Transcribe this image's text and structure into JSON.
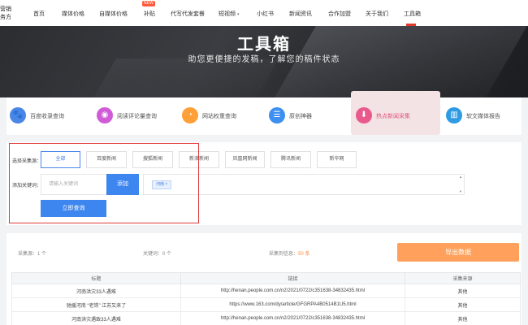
{
  "logo": {
    "line1": "营销",
    "line2": "务方"
  },
  "nav": {
    "items": [
      "首页",
      "媒体价格",
      "自媒体价格",
      "补贴",
      "代写代发套餐",
      "短视频",
      "小红书",
      "新闻资讯",
      "合作加盟",
      "关于我们",
      "工具箱"
    ],
    "badge": "NEW",
    "caret": "▾",
    "active": "工具箱"
  },
  "hero": {
    "title": "工具箱",
    "subtitle": "助您更便捷的发稿，了解您的稿件状态"
  },
  "tools": [
    {
      "label": "百度收录查询",
      "icon": "paw-icon",
      "color": "#4a86e8"
    },
    {
      "label": "阅读评论量查询",
      "icon": "eye-icon",
      "color": "#d05bd6"
    },
    {
      "label": "网站权重查询",
      "icon": "pie-chart-icon",
      "color": "#ff9f38"
    },
    {
      "label": "原创神器",
      "icon": "document-icon",
      "color": "#3d8ff0"
    },
    {
      "label": "热点新闻采集",
      "icon": "download-icon",
      "color": "#e85a8c"
    },
    {
      "label": "软文媒体报告",
      "icon": "chart-icon",
      "color": "#2f9be3"
    }
  ],
  "filter": {
    "source_label": "选择采集源：",
    "sources": [
      "全部",
      "百度新闻",
      "搜狐新闻",
      "新浪新闻",
      "凤凰网新闻",
      "腾讯新闻",
      "新华网"
    ],
    "active_source": "全部",
    "keyword_label": "添加关键词：",
    "keyword_placeholder": "请输入关键词",
    "add_button": "添加",
    "tags": [
      "河南 ×"
    ],
    "query_button": "立即查询"
  },
  "stats": {
    "source_label": "采集源：",
    "source_value": "1 个",
    "keyword_label": "关键词：",
    "keyword_value": "0 个",
    "count_label": "采集到信息：",
    "count_value": "50 条",
    "export_button": "导出数据"
  },
  "table": {
    "headers": [
      "标题",
      "链接",
      "采集来源"
    ],
    "rows": [
      [
        "河南洪灾33人遇难",
        "http://henan.people.com.cn/n2/2021/0722/c351638-34832435.html",
        "其他"
      ],
      [
        "驰援河南 “老铁” 江苏又来了",
        "https://www.163.com/dy/article/GFGRPA4B0514B1U5.html",
        "其他"
      ],
      [
        "河南洪灾遇致33人遇难",
        "http://henan.people.com.cn/n2/2021/0722/c351638-34832435.html",
        "其他"
      ]
    ]
  },
  "colors": {
    "accent": "#3d86f0",
    "export": "#ffa15c",
    "highlight_border": "#e03a3a",
    "nav_active": "#e23b2b"
  }
}
